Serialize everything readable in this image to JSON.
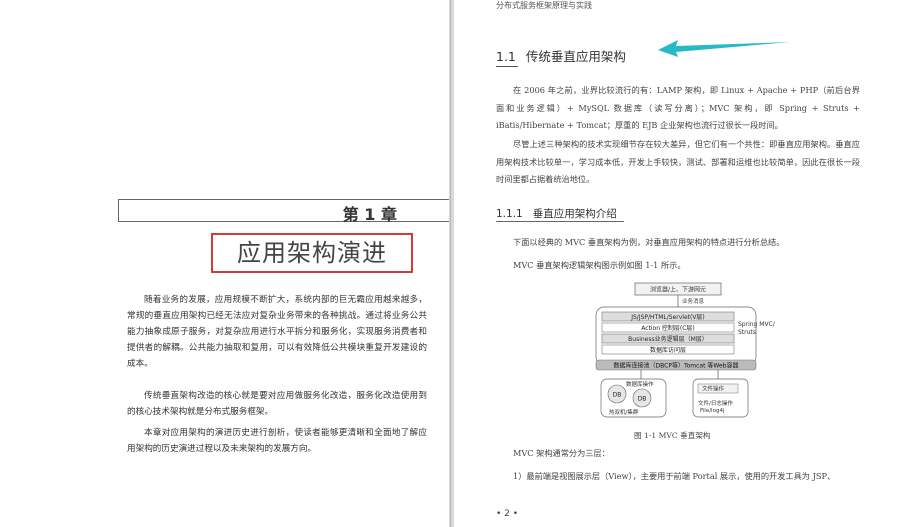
{
  "left_page": {
    "chapter_number": "第 1 章",
    "chapter_title": "应用架构演进",
    "paragraphs": [
      "随着业务的发展，应用规模不断扩大，系统内部的巨无霸应用越来越多，常规的垂直应用架构已经无法应对复杂业务带来的各种挑战。通过将业务公共能力抽象成原子服务，对复杂应用进行水平拆分和服务化，实现服务消费者和提供者的解耦。公共能力抽取和复用，可以有效降低公共模块重复开发建设的成本。",
      "传统垂直架构改造的核心就是要对应用做服务化改造，服务化改造使用到的核心技术架构就是分布式服务框架。",
      "本章对应用架构的演进历史进行剖析，使读者能够更清晰和全面地了解应用架构的历史演进过程以及未来架构的发展方向。"
    ]
  },
  "right_page": {
    "running_header": "分布式服务框架原理与实践",
    "section_number": "1.1",
    "section_title": "传统垂直应用架构",
    "paragraphs": [
      "在 2006 年之前，业界比较流行的有：LAMP 架构，即 Linux + Apache + PHP（前后台界面和业务逻辑）+ MySQL 数据库（读写分离）；MVC 架构，即 Spring + Struts + iBatis/Hibernate + Tomcat；厚重的 EJB 企业架构也流行过很长一段时间。",
      "尽管上述三种架构的技术实现细节存在较大差异，但它们有一个共性：即垂直应用架构。垂直应用架构技术比较单一，学习成本低，开发上手较快，测试、部署和运维也比较简单，因此在很长一段时间里都占据着统治地位。"
    ],
    "subsection_number": "1.1.1",
    "subsection_title": "垂直应用架构介绍",
    "para3": "下面以经典的 MVC 垂直架构为例，对垂直应用架构的特点进行分析总结。",
    "para4": "MVC 垂直架构逻辑架构图示例如图 1-1 所示。",
    "diagram": {
      "top_box": "浏览器/上、下游网元",
      "business_msg": "业务消息",
      "layer_view": "JS/JSP/HTML/Servlet(V层)",
      "layer_controller": "Action 控制层(C层)",
      "layer_model": "Business业务逻辑层（M层）",
      "layer_dao": "数据库访问层",
      "side_label_1": "Spring MVC/",
      "side_label_2": "Struts",
      "bottom_label": "数据库连接池（DBCP等）Tomcat 等Web容器",
      "db_op": "数据库操作",
      "db1": "DB",
      "db2": "DB",
      "db_cluster": "热双机/集群",
      "file_op": "文件操作",
      "file_log_1": "文件/日志操作",
      "file_log_2": "File/log4j"
    },
    "figure_caption": "图 1-1   MVC 垂直架构",
    "para5": "MVC 架构通常分为三层：",
    "para6": "1）最前端是视图展示层（View），主要用于前端 Portal 展示，使用的开发工具为 JSP、",
    "page_number": "• 2 •"
  },
  "colors": {
    "highlight_border": "#d63b3b",
    "annotation_arrow": "#27b9c8"
  }
}
